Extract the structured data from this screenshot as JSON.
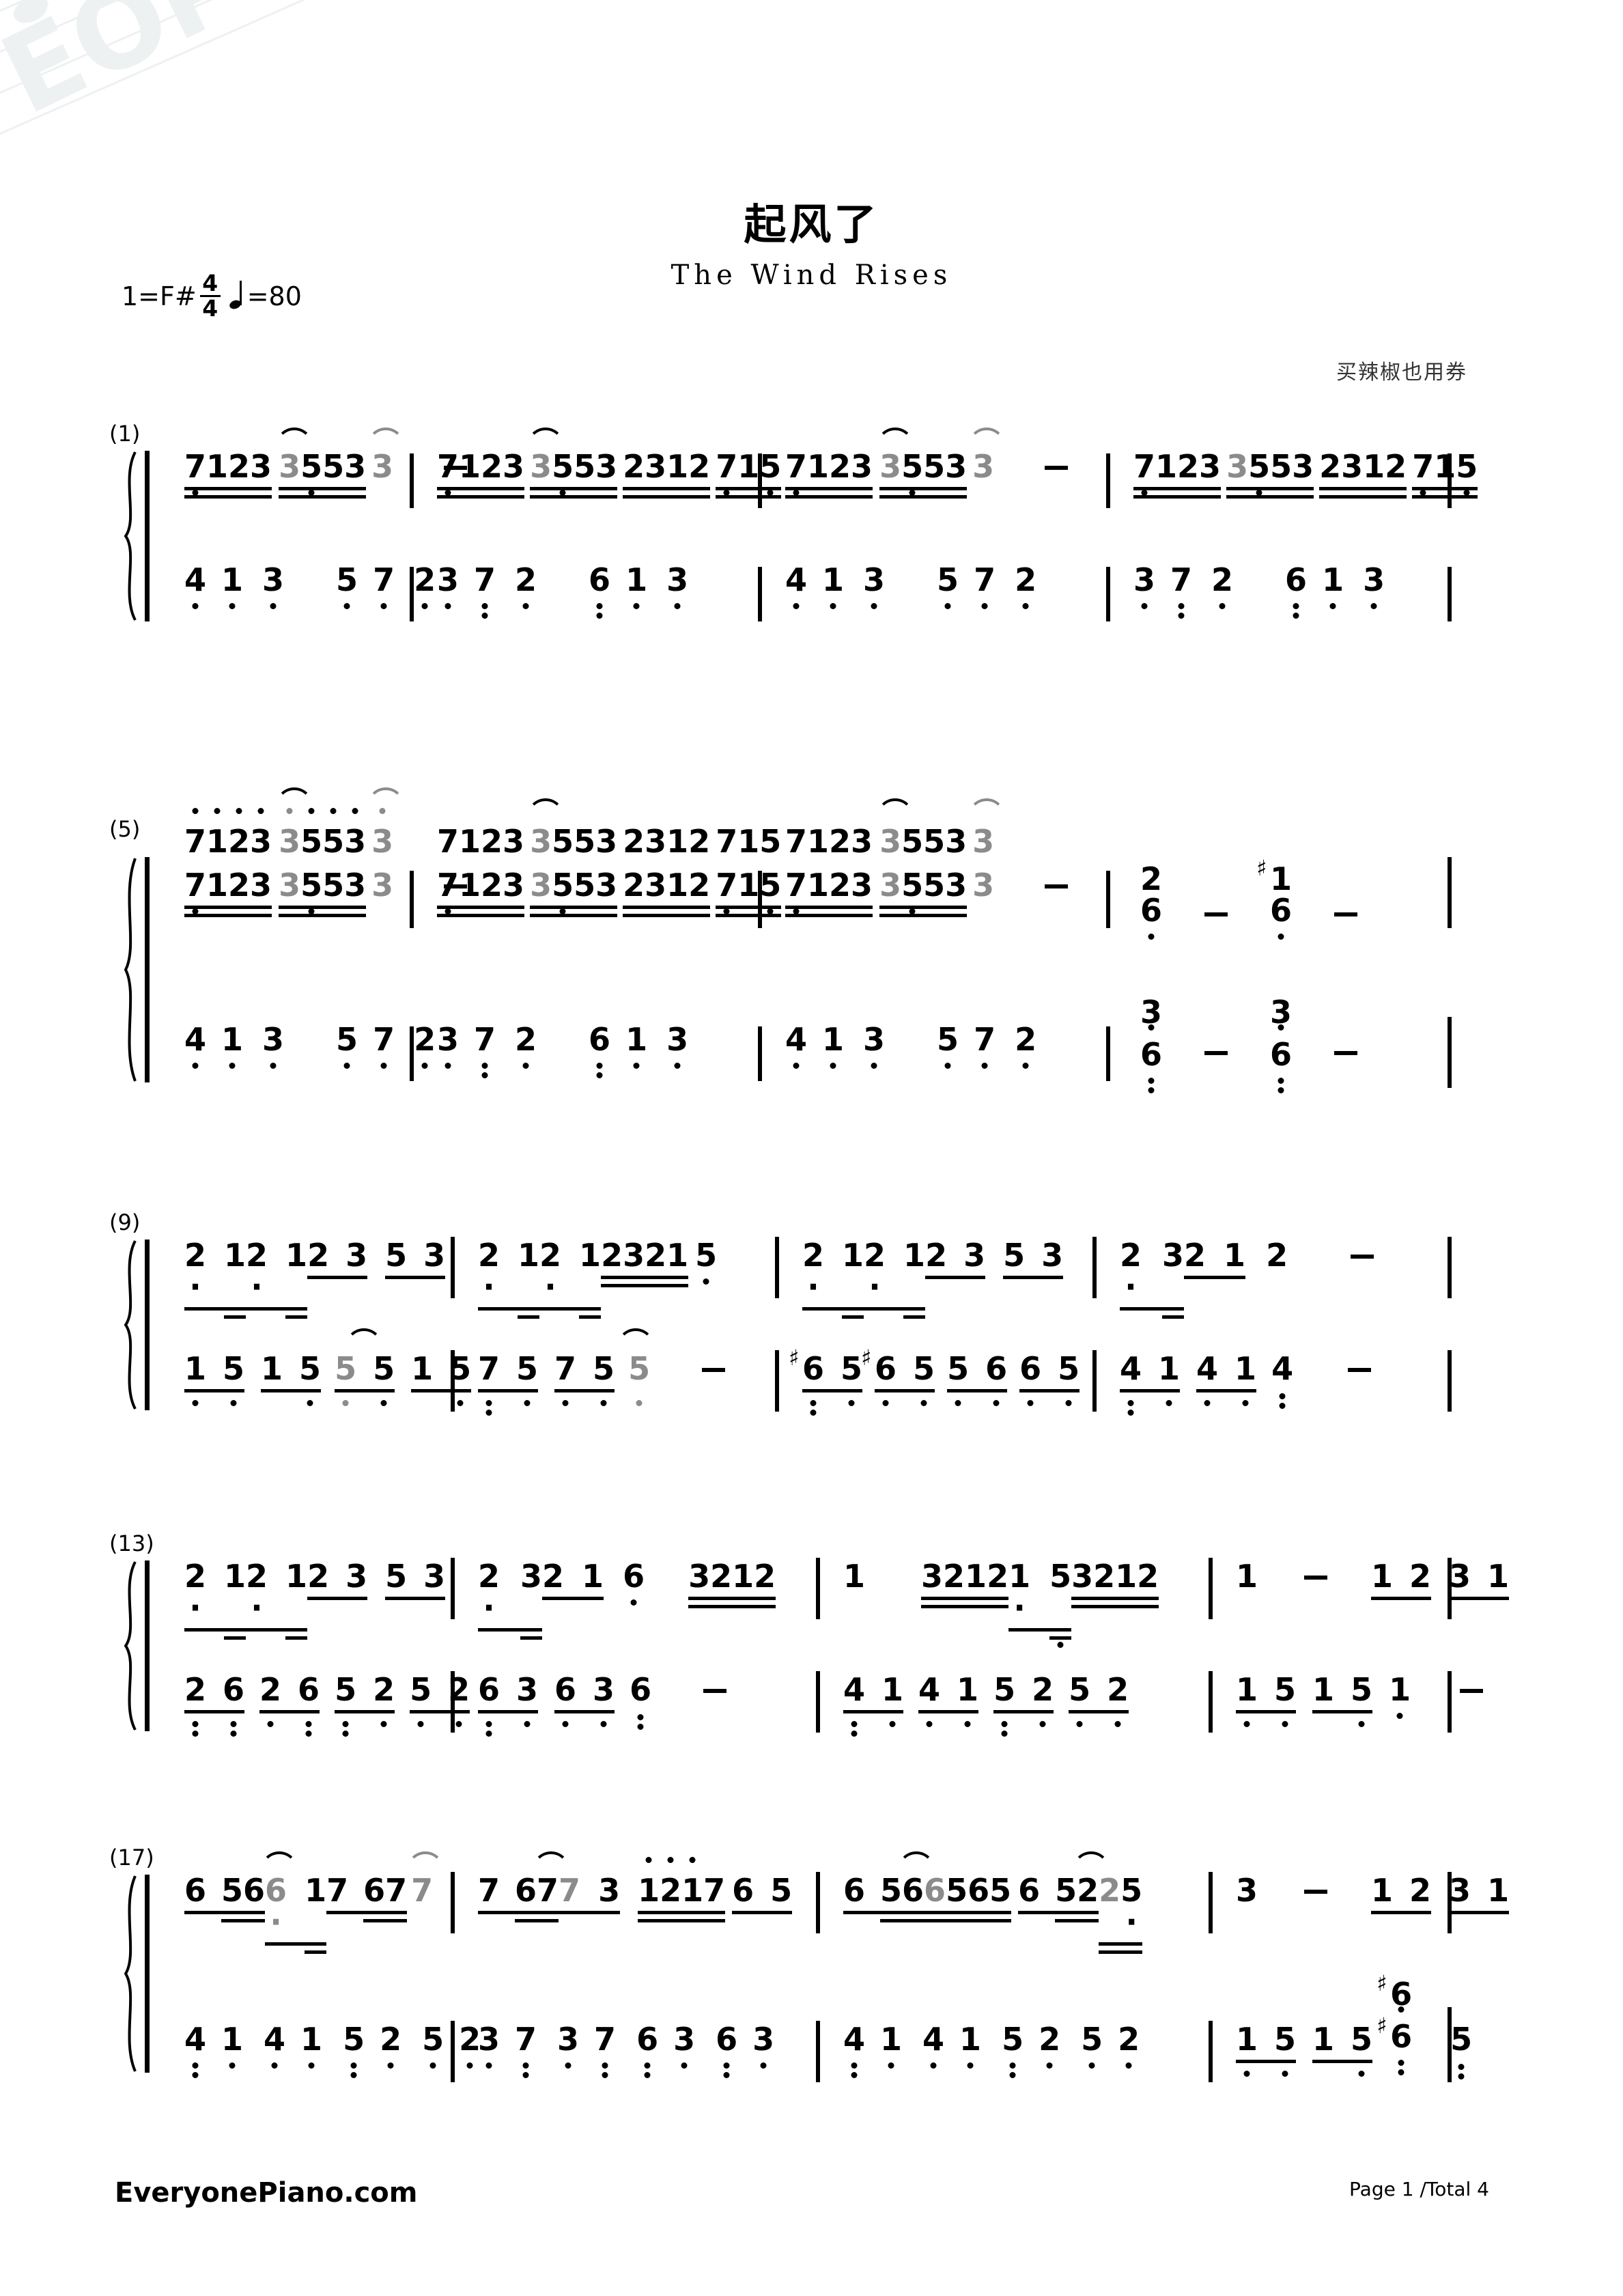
{
  "header": {
    "title": "起风了",
    "subtitle": "The Wind Rises",
    "key_label": "1=F#",
    "time_top": "4",
    "time_bottom": "4",
    "tempo_equals": "=80",
    "artist": "买辣椒也用券"
  },
  "footer": {
    "site": "EveryonePiano.com",
    "page": "Page 1 /Total 4"
  },
  "watermark": {
    "text": "EOP"
  },
  "chart_data": {
    "type": "table",
    "title": "起风了 — The Wind Rises",
    "notation": "jianpu-numbered-notation",
    "key": "1=F#",
    "time_signature": "4/4",
    "tempo_bpm": 80,
    "systems": [
      {
        "number": "(1)",
        "measures": [
          {
            "treble": "7123 3553 3 -",
            "bass": "4 1 3 5 7 2"
          },
          {
            "treble": "7123 3553 2312 715",
            "bass": "3 7 2 6 1 3"
          },
          {
            "treble": "7123 3553 3 -",
            "bass": "4 1 3 5 7 2"
          },
          {
            "treble": "7123 3553 2312 715",
            "bass": "3 7 2 6 1 3"
          }
        ]
      },
      {
        "number": "(5)",
        "measures": [
          {
            "treble_upper": "7123 3553 3",
            "treble": "7123 3553 3 -",
            "bass": "4 1 3 5 7 2"
          },
          {
            "treble_upper": "7123 3553 2312 715",
            "treble": "7123 3553 2312 715",
            "bass": "3 7 2 6 1 3"
          },
          {
            "treble_upper": "7123 3553 3",
            "treble": "7123 3553 3 -",
            "bass": "4 1 3 5 7 2"
          },
          {
            "treble": "2/6 - #1/6 -",
            "bass": "3/6 - 3/6 -"
          }
        ]
      },
      {
        "number": "(9)",
        "measures": [
          {
            "treble": "2· 1 2· 1 2 3 5 3",
            "bass": "1 5 1 5 5 5 1 5"
          },
          {
            "treble": "2· 1 2· 1 2321 5",
            "bass": "7 5 7 5 5 -"
          },
          {
            "treble": "2· 1 2· 1 2 3 5 3",
            "bass": "#6 5 #6 5 5 6 6 5"
          },
          {
            "treble": "2· 3 2 1 2 -",
            "bass": "4 1 4 1 4 -"
          }
        ]
      },
      {
        "number": "(13)",
        "measures": [
          {
            "treble": "2· 1 2· 1 2 3 5 3",
            "bass": "2 6 2 6 5 2 5 2"
          },
          {
            "treble": "2· 3 2 1 6 3212",
            "bass": "6 3 6 3 6 -"
          },
          {
            "treble": "1 3212 1· 5 3212",
            "bass": "4 1 4 1 5 2 5 2"
          },
          {
            "treble": "1 - 1 2 3 1",
            "bass": "1 5 1 5 1 -"
          }
        ]
      },
      {
        "number": "(17)",
        "measures": [
          {
            "treble": "6 56 6· 1 7 67 7",
            "bass": "4 1 4 1 5 2 5 2"
          },
          {
            "treble": "7 67 7 3 1217 6 5",
            "bass": "3 7 3 7 6 3 6 3"
          },
          {
            "treble": "6 56 6565 6 52 25·",
            "bass": "4 1 4 1 5 2 5 2"
          },
          {
            "treble": "3 - 1 2 3 1",
            "bass": "1 5 1 5 #6/#6 5"
          }
        ]
      }
    ]
  }
}
